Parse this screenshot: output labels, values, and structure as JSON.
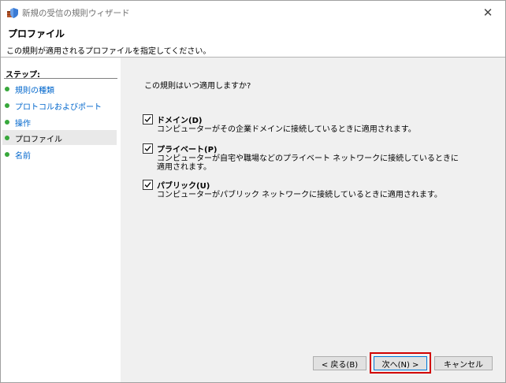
{
  "window": {
    "title": "新規の受信の規則ウィザード",
    "close_glyph": "✕"
  },
  "header": {
    "title": "プロファイル",
    "description": "この規則が適用されるプロファイルを指定してください。"
  },
  "steps": {
    "heading": "ステップ:",
    "items": [
      {
        "label": "規則の種類",
        "current": false
      },
      {
        "label": "プロトコルおよびポート",
        "current": false
      },
      {
        "label": "操作",
        "current": false
      },
      {
        "label": "プロファイル",
        "current": true
      },
      {
        "label": "名前",
        "current": false
      }
    ]
  },
  "main": {
    "question": "この規則はいつ適用しますか?",
    "options": [
      {
        "title": "ドメイン(D)",
        "description": "コンピューターがその企業ドメインに接続しているときに適用されます。",
        "checked": true
      },
      {
        "title": "プライベート(P)",
        "description": "コンピューターが自宅や職場などのプライベート ネットワークに接続しているときに適用されます。",
        "checked": true
      },
      {
        "title": "パブリック(U)",
        "description": "コンピューターがパブリック ネットワークに接続しているときに適用されます。",
        "checked": true
      }
    ]
  },
  "buttons": {
    "back": "< 戻る(B)",
    "next": "次へ(N) >",
    "cancel": "キャンセル"
  },
  "colors": {
    "step_dot": "#38a83c",
    "step_link": "#0066cc",
    "highlight": "#d10000",
    "focus_border": "#0078d7"
  }
}
